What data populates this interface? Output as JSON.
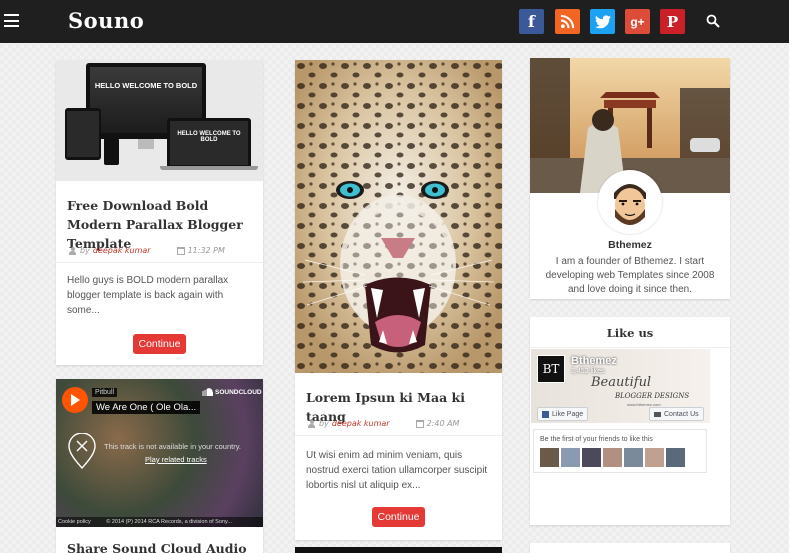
{
  "header": {
    "logo": "Souno",
    "social": [
      {
        "name": "facebook-button",
        "glyph": "f",
        "color": "#3b5998"
      },
      {
        "name": "rss-button",
        "glyph": "",
        "color": "#f26522"
      },
      {
        "name": "twitter-button",
        "glyph": "",
        "color": "#1da1f2"
      },
      {
        "name": "google-plus-button",
        "glyph": "g+",
        "color": "#dd4b39"
      },
      {
        "name": "pinterest-button",
        "glyph": "P",
        "color": "#cb2027"
      }
    ]
  },
  "posts": [
    {
      "title": "Free Download Bold Modern Parallax Blogger Template",
      "by": "by",
      "author": "deepak kumar",
      "time": "11:32 PM",
      "excerpt": "Hello guys is BOLD modern parallax blogger template is back again with some...",
      "continue": "Continue",
      "mock_text": "HELLO WELCOME TO BOLD"
    },
    {
      "title": "Lorem Ipsun ki Maa ki taang",
      "by": "by",
      "author": "deepak kumar",
      "time": "2:40 AM",
      "excerpt": "Ut wisi enim ad minim veniam, quis nostrud exerci tation ullamcorper suscipit lobortis nisl ut aliquip ex...",
      "continue": "Continue"
    },
    {
      "title": "Share Sound Cloud Audio",
      "soundcloud": {
        "artist": "Pitbull",
        "track": "We Are One ( Ole Ola...",
        "brand": "SOUNDCLOUD",
        "message": "This track is not available in your country.",
        "link": "Play related tracks",
        "cookie": "Cookie policy",
        "copyright": "© 2014 (P) 2014 RCA Records, a division of Sony..."
      }
    }
  ],
  "profile": {
    "name": "Bthemez",
    "bio": "I am a founder of Bthemez. I start developing web Templates since 2008 and love doing it since then."
  },
  "likebox": {
    "title": "Like us",
    "page_initials": "BT",
    "page_name": "Bthemez",
    "likes": "2,452 likes",
    "cover_line1": "Beautiful",
    "cover_line2": "BLOGGER DESIGNS",
    "cover_url": "www.bthemez.com",
    "like_button": "Like Page",
    "contact_button": "Contact Us",
    "friends_text": "Be the first of your friends to like this"
  }
}
